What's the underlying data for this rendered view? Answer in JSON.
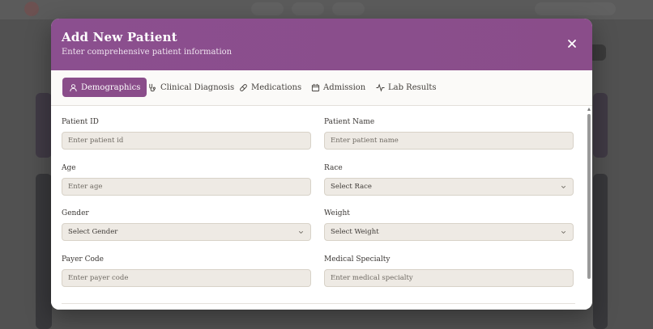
{
  "modal": {
    "title": "Add New Patient",
    "subtitle": "Enter comprehensive patient information",
    "header_color": "#8a4d8a"
  },
  "tabs": [
    {
      "label": "Demographics",
      "icon": "user-icon",
      "active": true
    },
    {
      "label": "Clinical Diagnosis",
      "icon": "stethoscope-icon",
      "active": false
    },
    {
      "label": "Medications",
      "icon": "pill-icon",
      "active": false
    },
    {
      "label": "Admission",
      "icon": "calendar-icon",
      "active": false
    },
    {
      "label": "Lab Results",
      "icon": "activity-icon",
      "active": false
    }
  ],
  "form": {
    "patient_id": {
      "label": "Patient ID",
      "placeholder": "Enter patient id"
    },
    "patient_name": {
      "label": "Patient Name",
      "placeholder": "Enter patient name"
    },
    "age": {
      "label": "Age",
      "placeholder": "Enter age"
    },
    "race": {
      "label": "Race",
      "value": "Select Race"
    },
    "gender": {
      "label": "Gender",
      "value": "Select Gender"
    },
    "weight": {
      "label": "Weight",
      "value": "Select Weight"
    },
    "payer_code": {
      "label": "Payer Code",
      "placeholder": "Enter payer code"
    },
    "medical_specialty": {
      "label": "Medical Specialty",
      "placeholder": "Enter medical specialty"
    }
  }
}
